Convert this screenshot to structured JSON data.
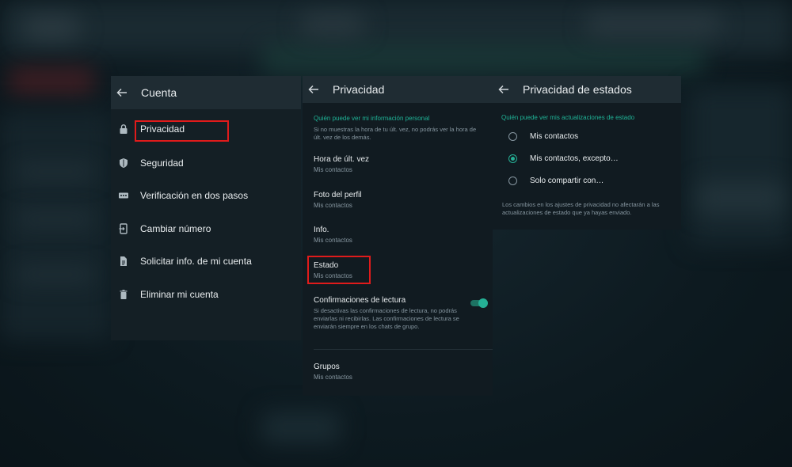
{
  "cuenta": {
    "title": "Cuenta",
    "items": [
      {
        "label": "Privacidad",
        "icon": "lock-icon"
      },
      {
        "label": "Seguridad",
        "icon": "shield-icon"
      },
      {
        "label": "Verificación en dos pasos",
        "icon": "dots-icon"
      },
      {
        "label": "Cambiar número",
        "icon": "phone-transfer-icon"
      },
      {
        "label": "Solicitar info. de mi cuenta",
        "icon": "document-icon"
      },
      {
        "label": "Eliminar mi cuenta",
        "icon": "trash-icon"
      }
    ]
  },
  "privacidad": {
    "title": "Privacidad",
    "section_title": "Quién puede ver mi información personal",
    "section_hint": "Si no muestras la hora de tu últ. vez, no podrás ver la hora de últ. vez de los demás.",
    "options": [
      {
        "title": "Hora de últ. vez",
        "value": "Mis contactos"
      },
      {
        "title": "Foto del perfil",
        "value": "Mis contactos"
      },
      {
        "title": "Info.",
        "value": "Mis contactos"
      },
      {
        "title": "Estado",
        "value": "Mis contactos"
      }
    ],
    "read_receipts": {
      "title": "Confirmaciones de lectura",
      "description": "Si desactivas las confirmaciones de lectura, no podrás enviarlas ni recibirlas. Las confirmaciones de lectura se enviarán siempre en los chats de grupo.",
      "enabled": true
    },
    "groups": {
      "title": "Grupos",
      "value": "Mis contactos"
    }
  },
  "estados": {
    "title": "Privacidad de estados",
    "section_title": "Quién puede ver mis actualizaciones de estado",
    "options": [
      {
        "label": "Mis contactos",
        "selected": false
      },
      {
        "label": "Mis contactos, excepto…",
        "selected": true
      },
      {
        "label": "Solo compartir con…",
        "selected": false
      }
    ],
    "note": "Los cambios en los ajustes de privacidad no afectarán a las actualizaciones de estado que ya hayas enviado."
  },
  "colors": {
    "accent": "#25b095",
    "highlight": "#e01b1b",
    "panel": "#111b21",
    "header": "#1f2c33"
  }
}
